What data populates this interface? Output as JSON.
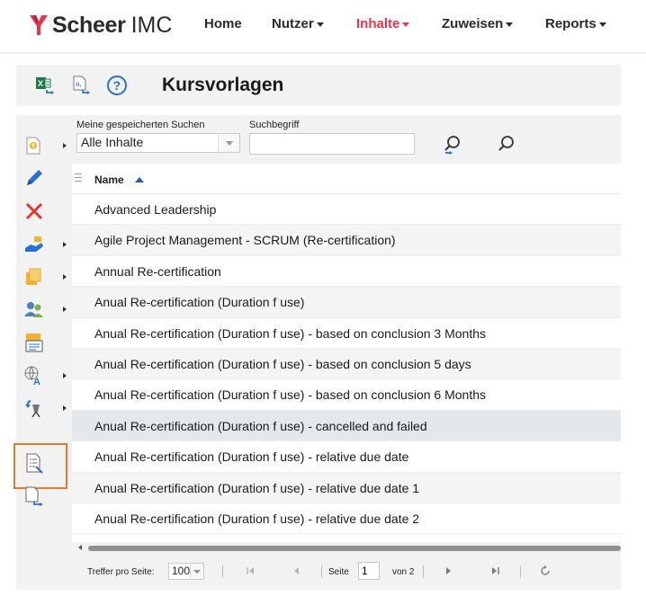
{
  "app": {
    "brand_bold": "Scheer",
    "brand_light": "IMC",
    "accent_color": "#e8354a"
  },
  "nav": {
    "items": [
      {
        "label": "Home",
        "has_dropdown": false,
        "active": false
      },
      {
        "label": "Nutzer",
        "has_dropdown": true,
        "active": false
      },
      {
        "label": "Inhalte",
        "has_dropdown": true,
        "active": true
      },
      {
        "label": "Zuweisen",
        "has_dropdown": true,
        "active": false
      },
      {
        "label": "Reports",
        "has_dropdown": true,
        "active": false
      }
    ]
  },
  "title_bar": {
    "title": "Kursvorlagen",
    "icons": [
      "excel-export-icon",
      "document-export-icon",
      "help-icon"
    ]
  },
  "left_toolbar": {
    "icons": [
      "new-course-icon",
      "edit-icon",
      "delete-icon",
      "assign-icon",
      "copy-icon",
      "users-icon",
      "catalog-icon",
      "translate-icon",
      "relocate-icon",
      "checklist-icon",
      "export-icon"
    ],
    "highlighted": "checklist-icon"
  },
  "search": {
    "saved_label": "Meine gespeicherten Suchen",
    "saved_value": "Alle Inhalte",
    "term_label": "Suchbegriff",
    "term_value": ""
  },
  "grid": {
    "column_name": "Name",
    "sort": "ascending",
    "rows": [
      "Advanced Leadership",
      "Agile Project Management - SCRUM (Re-certification)",
      "Annual Re-certification",
      "Anual Re-certification (Duration f use)",
      "Anual Re-certification (Duration f use) - based on conclusion 3 Months",
      "Anual Re-certification (Duration f use) - based on conclusion 5 days",
      "Anual Re-certification (Duration f use) - based on conclusion 6 Months",
      "Anual Re-certification (Duration f use) - cancelled and failed",
      "Anual Re-certification (Duration f use) - relative due date",
      "Anual Re-certification (Duration f use) - relative due date 1",
      "Anual Re-certification (Duration f use) - relative due date 2"
    ],
    "selected_row": 7
  },
  "pager": {
    "per_page_label": "Treffer pro Seite:",
    "per_page_value": "100",
    "page_label": "Seite",
    "page_value": "1",
    "of_label": "von 2"
  }
}
